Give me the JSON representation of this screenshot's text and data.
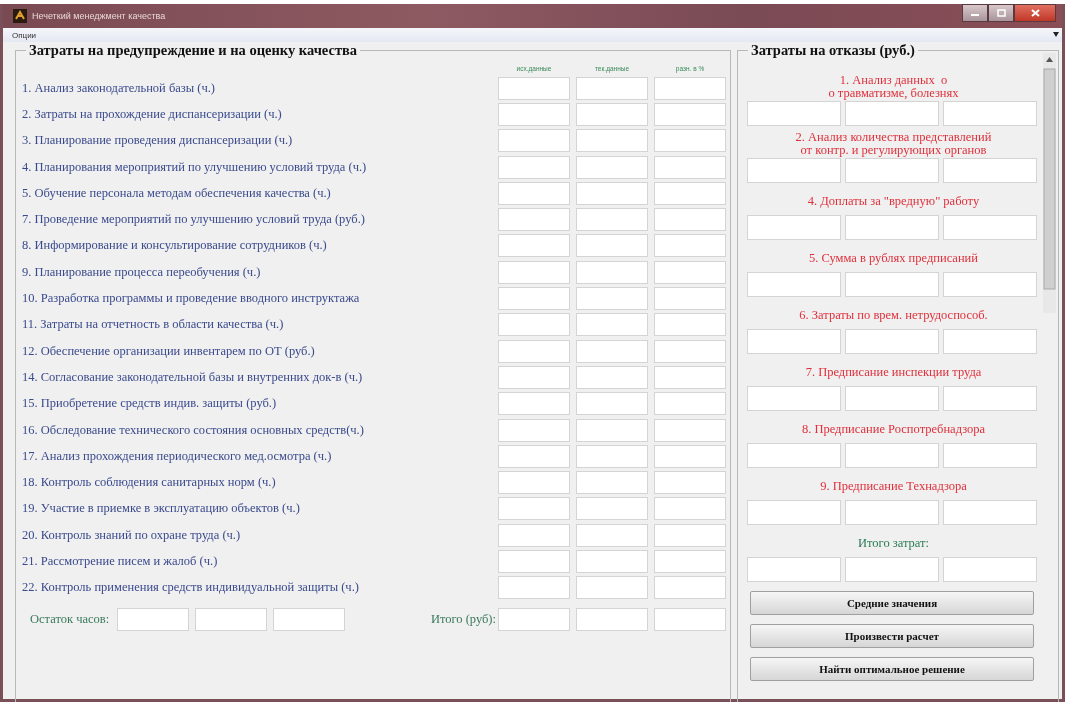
{
  "window": {
    "title": "Нечеткий менеджмент качества"
  },
  "menu": [
    "Опции"
  ],
  "prevention_panel": {
    "title": "Затраты на предупреждение и на оценку качества",
    "columns": [
      "исх.данные",
      "тек.данные",
      "разн. в %"
    ],
    "rows": [
      {
        "label": "1. Анализ законодательной базы (ч.)"
      },
      {
        "label": "2. Затраты на прохождение диспансеризации (ч.)"
      },
      {
        "label": "3. Планирование проведения диспансеризации (ч.)"
      },
      {
        "label": "4. Планирования мероприятий по улучшению условий труда (ч.)"
      },
      {
        "label": "5. Обучение персонала методам обеспечения качества (ч.)"
      },
      {
        "label": "7. Проведение мероприятий по улучшению условий труда (руб.)"
      },
      {
        "label": "8. Информирование и консультирование сотрудников (ч.)"
      },
      {
        "label": "9. Планирование процесса переобучения (ч.)"
      },
      {
        "label": "10. Разработка программы и проведение вводного инструктажа"
      },
      {
        "label": "11. Затраты на отчетность в области качества (ч.)"
      },
      {
        "label": "12. Обеспечение организации инвентарем по ОТ (руб.)"
      },
      {
        "label": "14. Согласование законодательной базы и внутренних док-в (ч.)"
      },
      {
        "label": "15. Приобретение средств индив. защиты (руб.)"
      },
      {
        "label": "16. Обследование технического состояния основных средств(ч.)"
      },
      {
        "label": "17. Анализ прохождения периодического мед.осмотра (ч.)"
      },
      {
        "label": "18. Контроль соблюдения санитарных норм (ч.)"
      },
      {
        "label": "19. Участие в приемке  в эксплуатацию объектов (ч.)"
      },
      {
        "label": "20. Контроль знаний по охране труда (ч.)"
      },
      {
        "label": "21. Рассмотрение писем и жалоб (ч.)"
      },
      {
        "label": "22. Контроль применения средств индивидуальной защиты (ч.)"
      }
    ],
    "remaining_label": "Остаток часов:",
    "total_label": "Итого (руб):"
  },
  "failure_panel": {
    "title": "Затраты на отказы (руб.)",
    "items": [
      {
        "kind": "item",
        "label": "1. Анализ данных  о\nо травматизме, болезнях"
      },
      {
        "kind": "item",
        "label": "2. Анализ количества представлений\nот контр. и регулирующих органов"
      },
      {
        "kind": "item",
        "label": "4. Доплаты за \"вредную\" работу"
      },
      {
        "kind": "item",
        "label": "5. Сумма в рублях предписаний"
      },
      {
        "kind": "item",
        "label": "6. Затраты по врем. нетрудоспособ."
      },
      {
        "kind": "item",
        "label": "7. Предписание инспекции труда"
      },
      {
        "kind": "item",
        "label": "8. Предписание Роспотребнадзора"
      },
      {
        "kind": "item",
        "label": "9. Предписание Технадзора"
      },
      {
        "kind": "total",
        "label": "Итого затрат:"
      }
    ],
    "buttons": [
      "Средние значения",
      "Произвести расчет",
      "Найти оптимальное решение"
    ]
  }
}
